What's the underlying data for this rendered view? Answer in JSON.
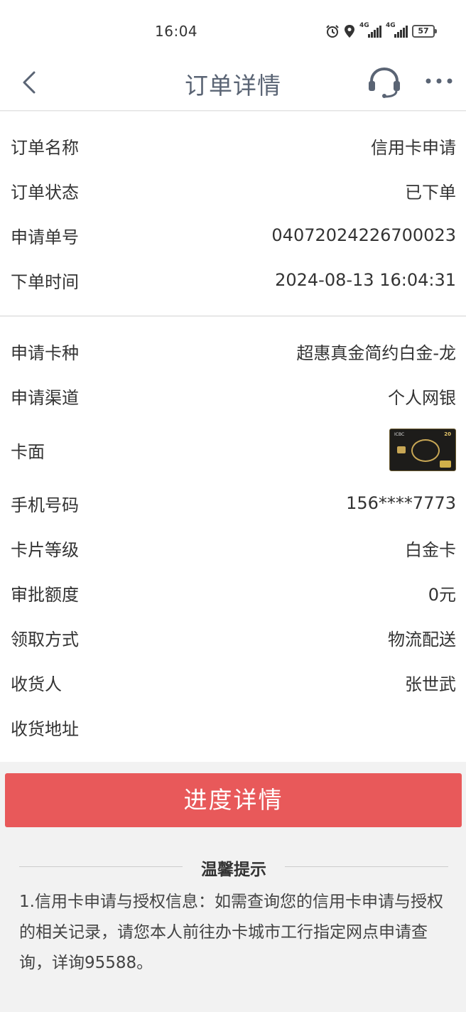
{
  "status_bar": {
    "time": "16:04",
    "net1": "4G",
    "net2": "4G",
    "battery": "57"
  },
  "header": {
    "title": "订单详情"
  },
  "order_info": [
    {
      "label": "订单名称",
      "value": "信用卡申请"
    },
    {
      "label": "订单状态",
      "value": "已下单"
    },
    {
      "label": "申请单号",
      "value": "04072024226700023"
    },
    {
      "label": "下单时间",
      "value": "2024-08-13 16:04:31"
    }
  ],
  "card_info": [
    {
      "label": "申请卡种",
      "value": "超惠真金简约白金-龙"
    },
    {
      "label": "申请渠道",
      "value": "个人网银"
    },
    {
      "label": "卡面",
      "value": ""
    },
    {
      "label": "手机号码",
      "value": "156****7773"
    },
    {
      "label": "卡片等级",
      "value": "白金卡"
    },
    {
      "label": "审批额度",
      "value": "0元"
    },
    {
      "label": "领取方式",
      "value": "物流配送"
    },
    {
      "label": "收货人",
      "value": "张世武"
    },
    {
      "label": "收货地址",
      "value": ""
    }
  ],
  "card_face": {
    "bank": "ICBC",
    "number": "20"
  },
  "progress_button": "进度详情",
  "tips": {
    "title": "温馨提示",
    "text": "1.信用卡申请与授权信息：如需查询您的信用卡申请与授权的相关记录，请您本人前往办卡城市工行指定网点申请查询，详询95588。"
  },
  "colors": {
    "accent": "#e8595a",
    "nav_title": "#5a6474"
  }
}
